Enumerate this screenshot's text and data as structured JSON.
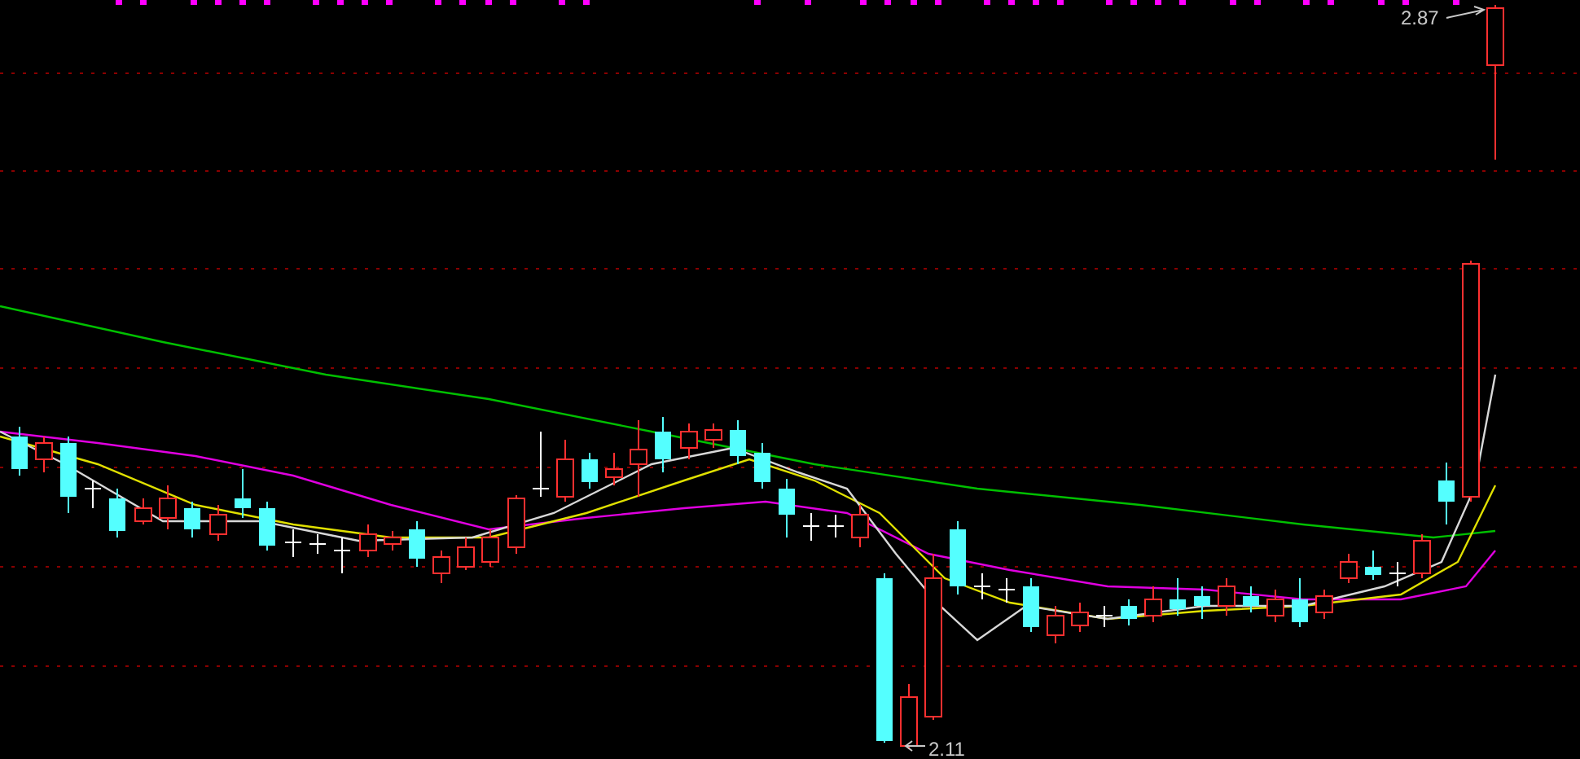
{
  "high_label": {
    "text": "2.87"
  },
  "low_label": {
    "text": "2.11"
  }
}
